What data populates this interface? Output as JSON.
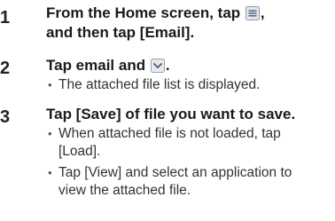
{
  "steps": [
    {
      "number": "1",
      "title_part1": "From the Home screen, tap",
      "title_part1_tail": ",",
      "title_line2": "and then tap [Email].",
      "icon": "menu-icon"
    },
    {
      "number": "2",
      "title_part1": "Tap email and",
      "title_part1_tail": ".",
      "icon": "chevron-down-icon",
      "bullets": [
        "The attached file list is displayed."
      ]
    },
    {
      "number": "3",
      "title": "Tap [Save] of file you want to save.",
      "bullets": [
        {
          "line1": "When attached file is not loaded, tap",
          "line2": "[Load]."
        },
        {
          "line1": "Tap [View] and select an application to",
          "line2": "view the attached file."
        }
      ]
    }
  ],
  "bullet_glyph": "•"
}
